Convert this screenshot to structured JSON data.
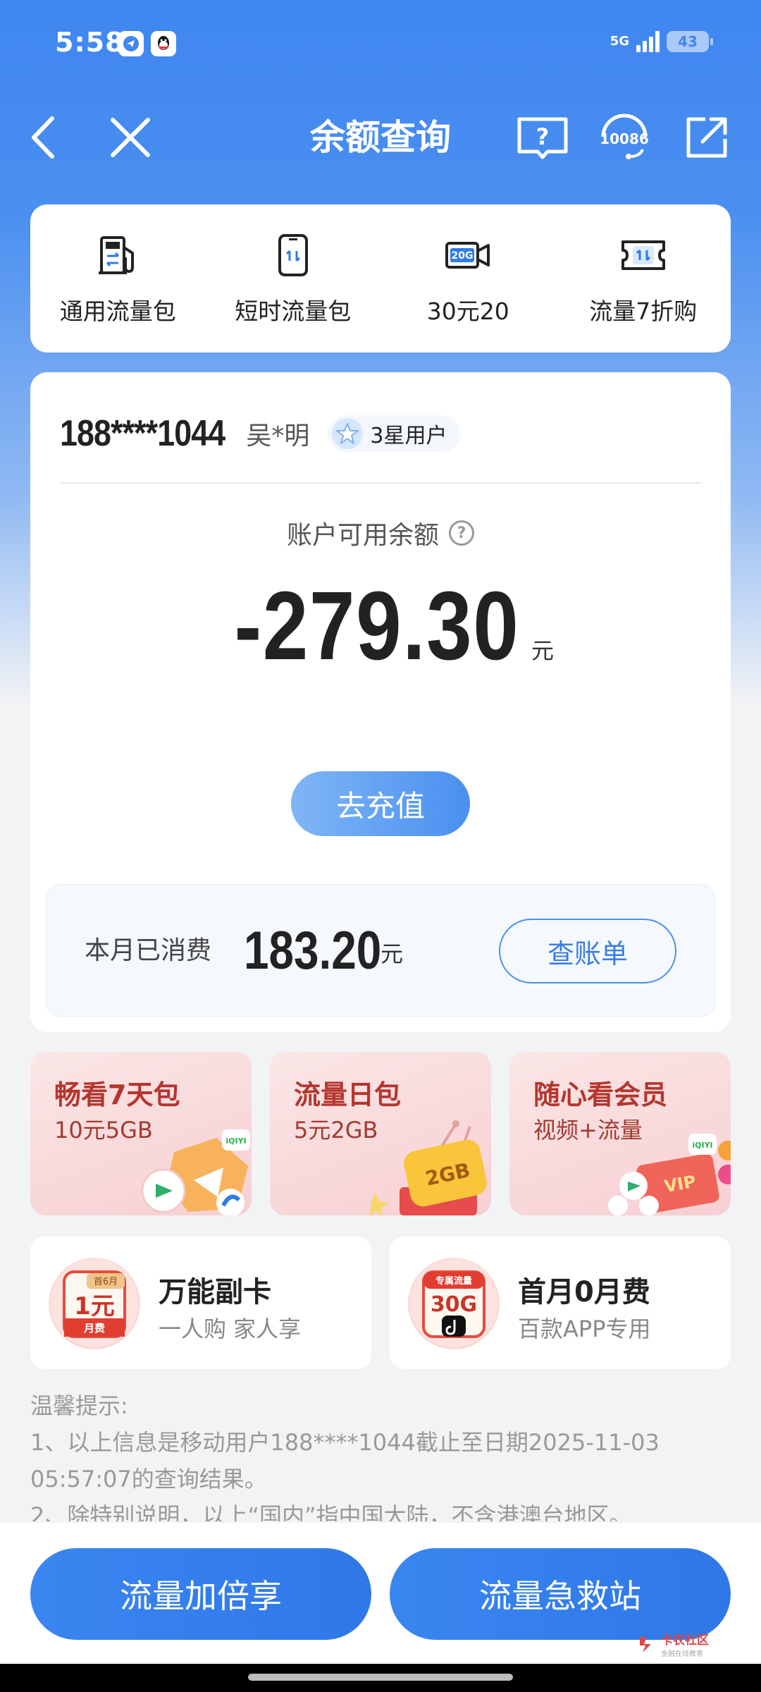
{
  "status": {
    "time": "5:58",
    "network": "5G",
    "battery": "43",
    "icons": [
      "telegram-icon",
      "qq-icon"
    ]
  },
  "nav": {
    "title": "余额查询",
    "service_label": "10086",
    "icons": [
      "back-icon",
      "close-icon",
      "help-book-icon",
      "customer-service-icon",
      "share-icon"
    ]
  },
  "shortcuts": [
    {
      "label": "通用流量包",
      "icon": "fuel-data-icon"
    },
    {
      "label": "短时流量包",
      "icon": "phone-data-icon"
    },
    {
      "label": "30元20",
      "icon": "video-20g-icon"
    },
    {
      "label": "流量7折购",
      "icon": "ticket-data-icon"
    }
  ],
  "account": {
    "phone": "188****1044",
    "name": "吴*明",
    "level": "3星用户",
    "balance_label": "账户可用余额",
    "balance": "-279.30",
    "unit": "元",
    "recharge": "去充值",
    "spend_label": "本月已消费",
    "spend": "183.20",
    "bill": "查账单"
  },
  "promos": [
    {
      "title": "畅看7天包",
      "sub": "10元5GB"
    },
    {
      "title": "流量日包",
      "sub": "5元2GB",
      "art_text": "2GB"
    },
    {
      "title": "随心看会员",
      "sub": "视频+流量",
      "art_text": "VIP"
    }
  ],
  "features": [
    {
      "title": "万能副卡",
      "sub": "一人购 家人享",
      "badge_top": "首6月",
      "badge_main": "1元",
      "badge_bottom": "月费"
    },
    {
      "title": "首月0月费",
      "sub": "百款APP专用",
      "badge_top": "专属流量",
      "badge_main": "30G"
    }
  ],
  "tips": {
    "title": "温馨提示:",
    "line1": "1、以上信息是移动用户188****1044截止至日期2025-11-03 05:57:07的查询结果。",
    "line2": "2、除特别说明，以上“国内”指中国大陆，不含港澳台地区。"
  },
  "bottom": {
    "left": "流量加倍享",
    "right": "流量急救站"
  },
  "watermark": {
    "main": "卡农社区",
    "sub": "金融在线教育"
  },
  "colors": {
    "primary": "#3f86f0",
    "promo_title": "#b4362e",
    "badge_red": "#d8423a"
  }
}
